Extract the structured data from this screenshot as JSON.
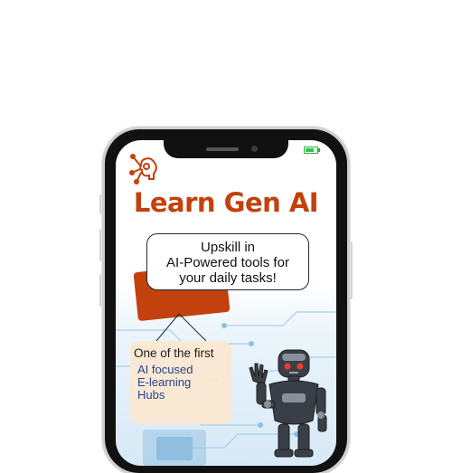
{
  "app": {
    "title": "Learn Gen AI",
    "headline_lines": [
      "Upskill in",
      "AI-Powered tools for",
      "your daily tasks!"
    ],
    "card_heading": "One of the first",
    "card_lines": [
      "AI focused",
      "E-learning",
      "Hubs"
    ]
  },
  "icons": {
    "logo": "brain-network-icon",
    "battery": "battery-icon",
    "robot": "robot-illustration"
  },
  "colors": {
    "brand": "#c2410c",
    "accent_blue": "#1e3a8a",
    "card_bg": "#fbe8d2",
    "battery_green": "#37c544"
  }
}
